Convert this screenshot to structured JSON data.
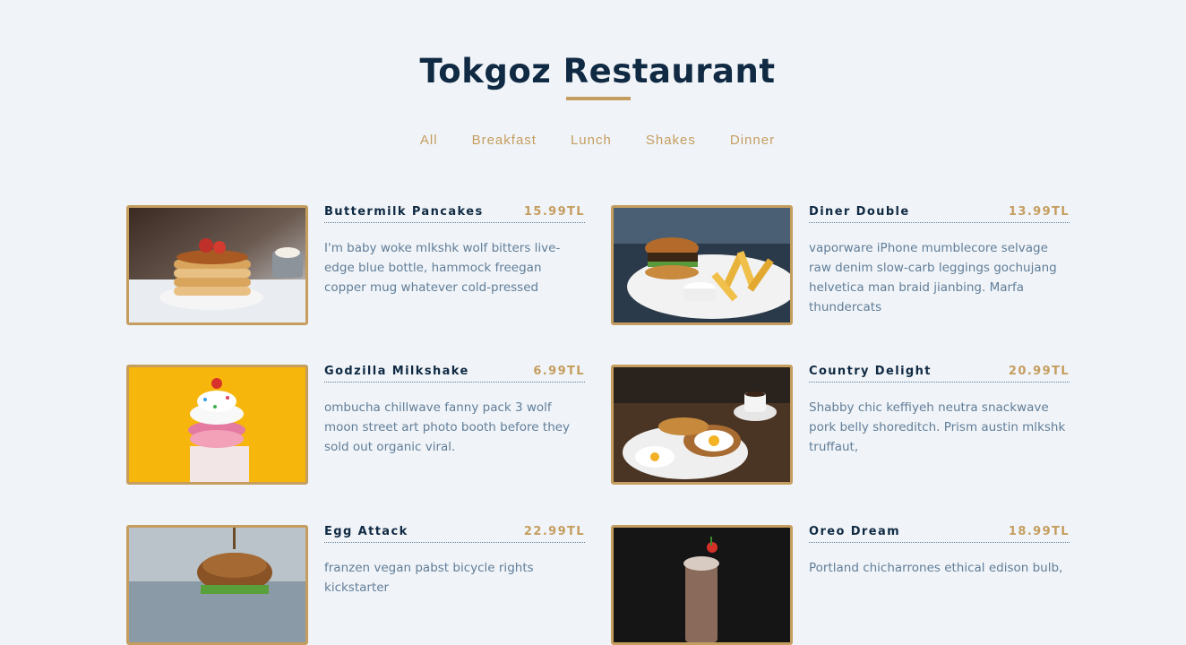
{
  "header": {
    "title": "Tokgoz Restaurant"
  },
  "filters": [
    "All",
    "Breakfast",
    "Lunch",
    "Shakes",
    "Dinner"
  ],
  "colors": {
    "accent": "#c59d5f",
    "title": "#102a43",
    "text": "#617d98",
    "background": "#f0f4f8"
  },
  "menu": [
    {
      "name": "Buttermilk Pancakes",
      "price": "15.99TL",
      "desc": "I'm baby woke mlkshk wolf bitters live-edge blue bottle, hammock freegan copper mug whatever cold-pressed",
      "image_alt": "pancakes-photo"
    },
    {
      "name": "Diner Double",
      "price": "13.99TL",
      "desc": "vaporware iPhone mumblecore selvage raw denim slow-carb leggings gochujang helvetica man braid jianbing. Marfa thundercats",
      "image_alt": "burger-fries-photo"
    },
    {
      "name": "Godzilla Milkshake",
      "price": "6.99TL",
      "desc": "ombucha chillwave fanny pack 3 wolf moon street art photo booth before they sold out organic viral.",
      "image_alt": "milkshake-photo"
    },
    {
      "name": "Country Delight",
      "price": "20.99TL",
      "desc": "Shabby chic keffiyeh neutra snackwave pork belly shoreditch. Prism austin mlkshk truffaut,",
      "image_alt": "eggs-toast-photo"
    },
    {
      "name": "Egg Attack",
      "price": "22.99TL",
      "desc": "franzen vegan pabst bicycle rights kickstarter",
      "image_alt": "egg-burger-photo"
    },
    {
      "name": "Oreo Dream",
      "price": "18.99TL",
      "desc": "Portland chicharrones ethical edison bulb,",
      "image_alt": "oreo-shake-photo"
    }
  ]
}
